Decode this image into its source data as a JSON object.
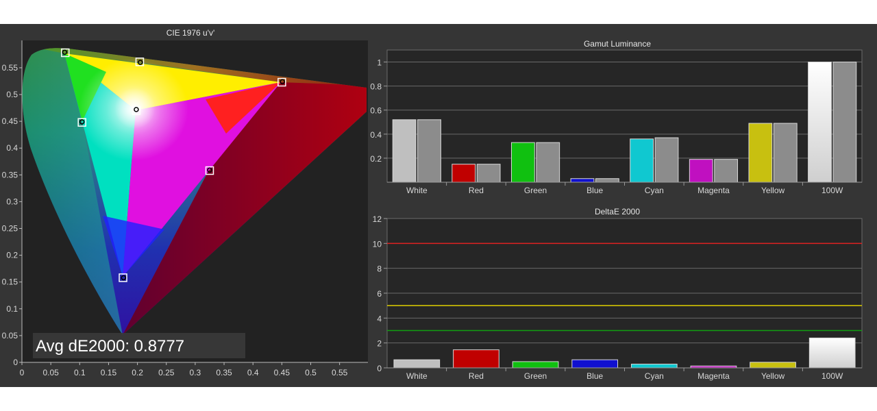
{
  "chart_data": [
    {
      "type": "scatter",
      "title": "CIE 1976 u'v'",
      "xlim": [
        0,
        0.6
      ],
      "ylim": [
        0,
        0.6
      ],
      "x_ticks": [
        "0",
        "0.05",
        "0.1",
        "0.15",
        "0.2",
        "0.25",
        "0.3",
        "0.35",
        "0.4",
        "0.45",
        "0.5",
        "0.55"
      ],
      "y_ticks": [
        "0",
        "0.05",
        "0.1",
        "0.15",
        "0.2",
        "0.25",
        "0.3",
        "0.35",
        "0.4",
        "0.45",
        "0.5",
        "0.55"
      ],
      "targets": [
        {
          "u": 0.45,
          "v": 0.523
        },
        {
          "u": 0.075,
          "v": 0.578
        },
        {
          "u": 0.175,
          "v": 0.158
        },
        {
          "u": 0.104,
          "v": 0.448
        },
        {
          "u": 0.325,
          "v": 0.358
        },
        {
          "u": 0.204,
          "v": 0.561
        },
        {
          "u": 0.198,
          "v": 0.47
        }
      ],
      "measured": [
        {
          "u": 0.451,
          "v": 0.524
        },
        {
          "u": 0.074,
          "v": 0.579
        },
        {
          "u": 0.176,
          "v": 0.158
        },
        {
          "u": 0.104,
          "v": 0.449
        },
        {
          "u": 0.325,
          "v": 0.359
        },
        {
          "u": 0.205,
          "v": 0.56
        },
        {
          "u": 0.198,
          "v": 0.472
        }
      ],
      "annotation": "Avg dE2000: 0.8777"
    },
    {
      "type": "bar",
      "title": "Gamut Luminance",
      "categories": [
        "White",
        "Red",
        "Green",
        "Blue",
        "Cyan",
        "Magenta",
        "Yellow",
        "100W"
      ],
      "series": [
        {
          "values": [
            0.52,
            0.15,
            0.33,
            0.03,
            0.36,
            0.19,
            0.49,
            1.0
          ]
        },
        {
          "values": [
            0.52,
            0.15,
            0.33,
            0.03,
            0.37,
            0.19,
            0.49,
            1.0
          ]
        }
      ],
      "colors": [
        "#bfbfbf",
        "#c00000",
        "#10c010",
        "#1010d0",
        "#10c8d0",
        "#c010c0",
        "#c8c010",
        "#ffffff"
      ],
      "reference_color": "#8c8c8c",
      "ylim": [
        0,
        1.1
      ],
      "y_ticks": [
        "0.2",
        "0.4",
        "0.6",
        "0.8",
        "1"
      ],
      "grid": true
    },
    {
      "type": "bar",
      "title": "DeltaE 2000",
      "categories": [
        "White",
        "Red",
        "Green",
        "Blue",
        "Cyan",
        "Magenta",
        "Yellow",
        "100W"
      ],
      "values": [
        0.65,
        1.45,
        0.5,
        0.65,
        0.3,
        0.15,
        0.45,
        2.4
      ],
      "colors": [
        "#bfbfbf",
        "#c00000",
        "#10c010",
        "#1010d0",
        "#10c8d0",
        "#c010c0",
        "#c8c010",
        "#ffffff"
      ],
      "ylim": [
        0,
        12
      ],
      "y_ticks": [
        "0",
        "2",
        "4",
        "6",
        "8",
        "10",
        "12"
      ],
      "thresholds": [
        {
          "value": 10,
          "color": "#e02020"
        },
        {
          "value": 5,
          "color": "#e0d000"
        },
        {
          "value": 3,
          "color": "#10a010"
        }
      ],
      "grid": true
    }
  ]
}
